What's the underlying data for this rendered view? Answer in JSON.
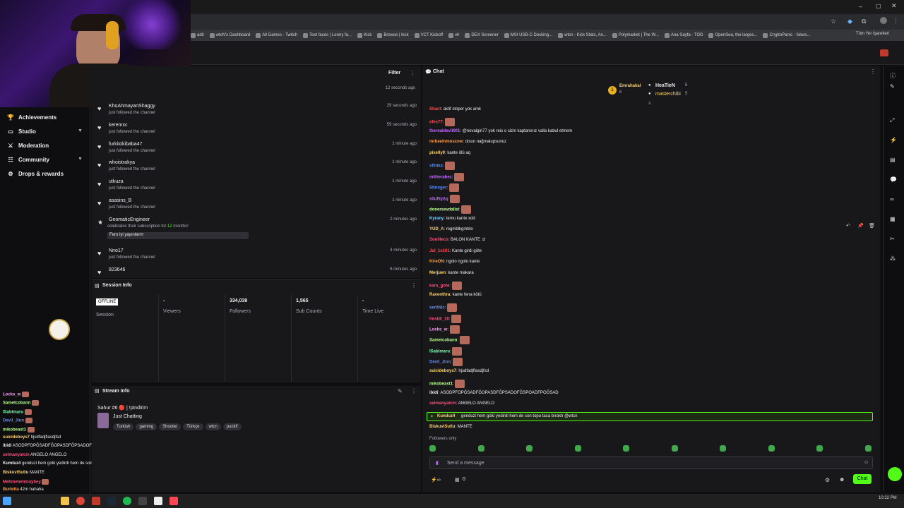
{
  "browser": {
    "bookmarks": [
      "adit",
      "wtcN's Dashboard",
      "All Games - Twitch",
      "Text faces | Lenny fa...",
      "Kick",
      "Browse | kick",
      "VCT Kickoff",
      "vlr",
      "DEX Screener",
      "MSI USB-C Docking...",
      "wtcn - Kick Stats, An...",
      "Polymarket | The W...",
      "Ana Sayfa - TOD",
      "OpenSea, the larges...",
      "CryptoPanic - News..."
    ],
    "other_bookmarks": "Tüm Yer İşaretleri"
  },
  "sidebar": {
    "items": [
      {
        "label": "Achievements",
        "icon": "trophy-icon"
      },
      {
        "label": "Studio",
        "icon": "monitor-icon"
      },
      {
        "label": "Moderation",
        "icon": "sword-icon"
      },
      {
        "label": "Community",
        "icon": "community-icon"
      },
      {
        "label": "Drops & rewards",
        "icon": "gift-icon"
      }
    ]
  },
  "activity": {
    "filter_label": "Filter",
    "top_time": "12 seconds ago",
    "items": [
      {
        "name": "KhoAhmayanShaggy",
        "sub": "just followed the channel",
        "time": "29 seconds ago"
      },
      {
        "name": "keremxc",
        "sub": "just followed the channel",
        "time": "59 seconds ago"
      },
      {
        "name": "furkitokibaba47",
        "sub": "just followed the channel",
        "time": "1 minute ago"
      },
      {
        "name": "whoistrakya",
        "sub": "just followed the channel",
        "time": "1 minute ago"
      },
      {
        "name": "utkuza",
        "sub": "just followed the channel",
        "time": "1 minute ago"
      },
      {
        "name": "asasins_B",
        "sub": "just followed the channel",
        "time": "1 minute ago"
      }
    ],
    "sub_event": {
      "name": "GeomaticEngineer",
      "text_pre": "celebrates their subscription for",
      "months": "12",
      "text_post": "months!",
      "message": "Fero iyi yayınlarrrr",
      "time": "2 minutes ago"
    },
    "tail": [
      {
        "name": "Nno17",
        "sub": "just followed the channel",
        "time": "4 minutes ago"
      },
      {
        "name": "823646",
        "sub": "",
        "time": "6 minutes ago"
      }
    ]
  },
  "session": {
    "title": "Session Info",
    "status_badge": "OFFLINE",
    "session_label": "Session",
    "stats": [
      {
        "value": "-",
        "label": "Viewers"
      },
      {
        "value": "334,039",
        "label": "Followers"
      },
      {
        "value": "1,565",
        "label": "Sub Counts"
      },
      {
        "value": "-",
        "label": "Time Live"
      }
    ]
  },
  "stream": {
    "title": "Stream Info",
    "stream_title": "Sahur #6 🔴 | !pindirim",
    "category": "Just Chatting",
    "tags": [
      "Turkish",
      "gaming",
      "Shooter",
      "Türkçe",
      "wtcn",
      "pozitif"
    ]
  },
  "left_chat": [
    {
      "user": "Locks_w",
      "text": "",
      "color": "#ff9ff3"
    },
    {
      "user": "Sametcobann",
      "text": "",
      "color": "#b8ff8f"
    },
    {
      "user": "ISabimaru",
      "text": "",
      "color": "#7bffb0"
    },
    {
      "user": "Devil_Jinn",
      "text": "",
      "color": "#5b8cff"
    },
    {
      "user": "mikobeast1",
      "text": "",
      "color": "#b8ff8f"
    },
    {
      "user": "suicideboys7",
      "text": "hjsdfadjflasdjfsd",
      "color": "#ffd36b"
    },
    {
      "user": "ibidi",
      "text": "ASODPFOPĞSADFĞOPASDFĞPSADOFĞSPOADFPOĞSAD",
      "color": "#efeff1"
    },
    {
      "user": "selmanyalcin",
      "text": "ANGELO ANGELO",
      "color": "#ff4f7b"
    },
    {
      "user": "Kunduz4",
      "text": "genduzi hem golü yedirdi hem de son topu taca bıraktı @wtcn",
      "color": "#efeff1"
    },
    {
      "user": "BiskuviSutlu",
      "text": "MANTE",
      "color": "#ffd36b"
    },
    {
      "user": "Mehmeteminaybey",
      "text": "",
      "color": "#ff4f7b"
    },
    {
      "user": "Burletta",
      "text": "42m hahaha",
      "color": "#ff9f43"
    }
  ],
  "chat": {
    "title": "Chat",
    "leaderboard": [
      {
        "name": "Emrahakal",
        "count": "6",
        "rank": "1"
      },
      {
        "name": "HeaTieN",
        "count": "5",
        "rank": ""
      },
      {
        "name": "masterchibi",
        "count": "5",
        "rank": ""
      }
    ],
    "messages": [
      {
        "user": "Shact",
        "text": "aktif stoper yok amk",
        "color": "#ff4f4f",
        "emote": false
      },
      {
        "user": "efes77",
        "text": "",
        "color": "#ff4f4f",
        "emote": true
      },
      {
        "user": "therealdevil001",
        "text": "@novalgin77 yok reis o sizin kaptanınız valla kabul etmem",
        "color": "#c16bff",
        "emote": false
      },
      {
        "user": "mrbeeinmoscow",
        "text": "olsun nağmalupsunuz",
        "color": "#ff9f43",
        "emote": false
      },
      {
        "user": "pixelly0",
        "text": "kante ölü aq",
        "color": "#ffd36b",
        "emote": false
      },
      {
        "user": "xflniks",
        "text": "",
        "color": "#5b8cff",
        "emote": true
      },
      {
        "user": "mitherabez",
        "text": "",
        "color": "#c16bff",
        "emote": true
      },
      {
        "user": "Stinnger",
        "text": "",
        "color": "#5b8cff",
        "emote": true
      },
      {
        "user": "s0uflly2q",
        "text": "",
        "color": "#c16bff",
        "emote": true
      },
      {
        "user": "donersevdalisi",
        "text": "",
        "color": "#b8ff8f",
        "emote": true
      },
      {
        "user": "Kyrany",
        "text": "temu kante xdd",
        "color": "#7bd3ff",
        "emote": false
      },
      {
        "user": "YUD_A",
        "text": "rogmblkgmbto",
        "color": "#ffd36b",
        "emote": false
      },
      {
        "user": "Sonilleco",
        "text": "BALON KANTE :d",
        "color": "#ff4f7b",
        "emote": false
      },
      {
        "user": "Jul_1e101",
        "text": "Kante girdi göte",
        "color": "#ff4f4f",
        "emote": false
      },
      {
        "user": "KireON",
        "text": "ngolo ngolo kante",
        "color": "#ff9f43",
        "emote": false
      },
      {
        "user": "Merjuen",
        "text": "kante makara",
        "color": "#ffd36b",
        "emote": false
      },
      {
        "user": "kara_gote",
        "text": "",
        "color": "#ff4f7b",
        "emote": true
      },
      {
        "user": "Raventhra",
        "text": "kante fena kötü",
        "color": "#ffd36b",
        "emote": false
      },
      {
        "user": "ser0NIc",
        "text": "",
        "color": "#5b8cff",
        "emote": true
      },
      {
        "user": "hosidi_16",
        "text": "",
        "color": "#ff4f7b",
        "emote": true
      },
      {
        "user": "Locks_w",
        "text": "",
        "color": "#ff9ff3",
        "emote": true
      },
      {
        "user": "Sametcobann",
        "text": "",
        "color": "#b8ff8f",
        "emote": true
      },
      {
        "user": "ISabimaru",
        "text": "",
        "color": "#7bffb0",
        "emote": true
      },
      {
        "user": "Devil_Jinn",
        "text": "",
        "color": "#5b8cff",
        "emote": true
      },
      {
        "user": "suicideboys7",
        "text": "hjsdfadjflasdjfsd",
        "color": "#ffd36b",
        "emote": false
      },
      {
        "user": "mikobeast1",
        "text": "",
        "color": "#b8ff8f",
        "emote": true
      },
      {
        "user": "ibidi",
        "text": "ASODPFOPĞSADFĞOPASDFĞPSADOFĞSPOADFPOĞSAD",
        "color": "#efeff1",
        "emote": false
      },
      {
        "user": "selmanyalcin",
        "text": "ANGELO ANGELO",
        "color": "#ff4f7b",
        "emote": false
      }
    ],
    "highlight": {
      "user": "Kunduz4",
      "text": "genduzi hem golü yedirdi hem de son topu taca bıraktı @wtcn"
    },
    "last": {
      "user": "BiskuviSutlu",
      "text": "MANTE",
      "color": "#ffd36b"
    },
    "followers_only": "Followers only",
    "input_placeholder": "Send a message",
    "points": "0",
    "send_label": "Chat"
  },
  "taskbar": {
    "time": "10:22 PM"
  },
  "colors": {
    "accent": "#53fc18",
    "bg": "#0e0e10",
    "panel": "#18181b"
  }
}
